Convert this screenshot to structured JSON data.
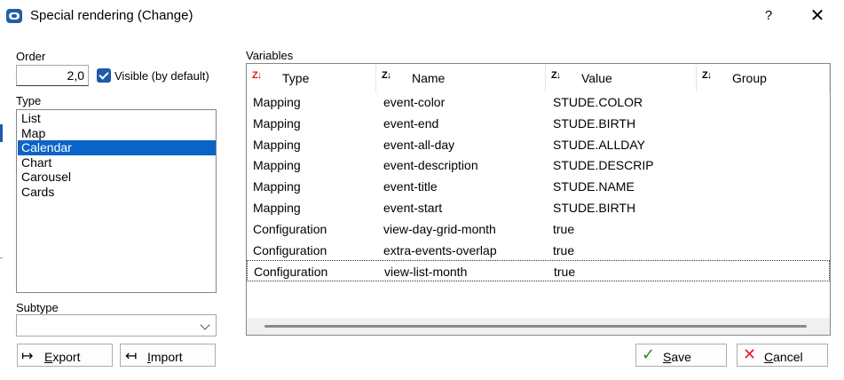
{
  "window": {
    "title": "Special rendering (Change)",
    "help_label": "?",
    "close_label": "✕"
  },
  "order": {
    "label": "Order",
    "value": "2,0"
  },
  "visible": {
    "label": "Visible (by default)",
    "checked": true
  },
  "type": {
    "label": "Type",
    "items": [
      "List",
      "Map",
      "Calendar",
      "Chart",
      "Carousel",
      "Cards"
    ],
    "selected": "Calendar"
  },
  "subtype": {
    "label": "Subtype",
    "value": ""
  },
  "buttons": {
    "export_label": "Export",
    "export_icon": "↦",
    "import_label": "Import",
    "import_icon": "↤",
    "save_label": "Save",
    "save_icon": "✓",
    "cancel_label": "Cancel",
    "cancel_icon": "✕"
  },
  "variables": {
    "label": "Variables",
    "columns": [
      "Type",
      "Name",
      "Value",
      "Group"
    ],
    "rows": [
      {
        "type": "Mapping",
        "name": "event-color",
        "value": "STUDE.COLOR",
        "group": ""
      },
      {
        "type": "Mapping",
        "name": "event-end",
        "value": "STUDE.BIRTH",
        "group": ""
      },
      {
        "type": "Mapping",
        "name": "event-all-day",
        "value": "STUDE.ALLDAY",
        "group": ""
      },
      {
        "type": "Mapping",
        "name": "event-description",
        "value": "STUDE.DESCRIP",
        "group": ""
      },
      {
        "type": "Mapping",
        "name": "event-title",
        "value": "STUDE.NAME",
        "group": ""
      },
      {
        "type": "Mapping",
        "name": "event-start",
        "value": "STUDE.BIRTH",
        "group": ""
      },
      {
        "type": "Configuration",
        "name": "view-day-grid-month",
        "value": "true",
        "group": ""
      },
      {
        "type": "Configuration",
        "name": "extra-events-overlap",
        "value": "true",
        "group": ""
      },
      {
        "type": "Configuration",
        "name": "view-list-month",
        "value": "true",
        "group": ""
      }
    ]
  },
  "colors": {
    "accent": "#0a64c8",
    "sort_icon_active": "#d42020",
    "cancel_icon": "#e02020",
    "save_icon": "#2a8a2a"
  }
}
